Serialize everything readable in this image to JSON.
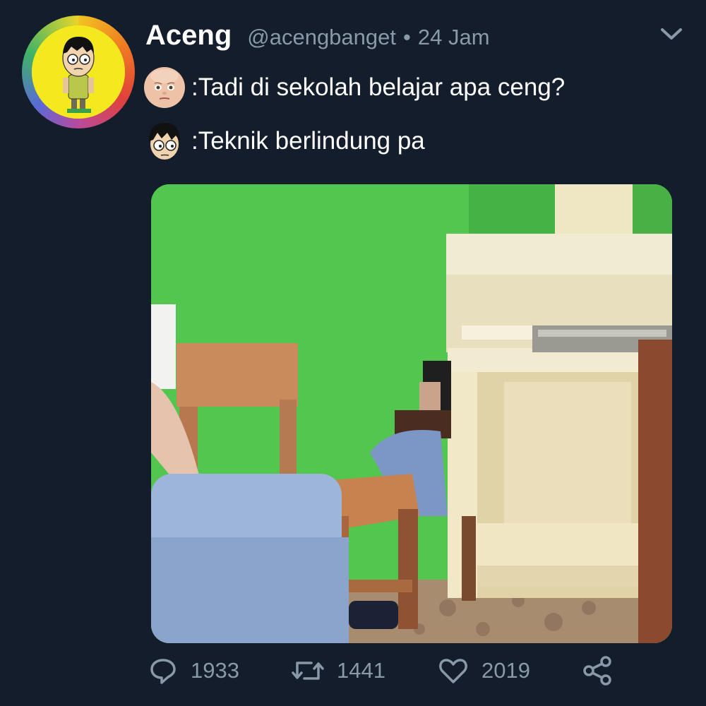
{
  "tweet": {
    "display_name": "Aceng",
    "handle": "@acengbanget",
    "separator": "•",
    "time": "24 Jam",
    "lines": [
      {
        "speaker_icon": "boss-baby-face-icon",
        "text": ":Tadi di sekolah belajar apa ceng?"
      },
      {
        "speaker_icon": "aceng-face-icon",
        "text": ":Teknik berlindung pa"
      }
    ],
    "media_alt": "Photo of a student hiding in a corner behind a wooden chair and cabinet against a green wall"
  },
  "actions": {
    "replies": "1933",
    "retweets": "1441",
    "likes": "2019"
  },
  "colors": {
    "background": "#141d2b",
    "text": "#ffffff",
    "muted": "#8899a8",
    "wall": "#52c64f"
  }
}
